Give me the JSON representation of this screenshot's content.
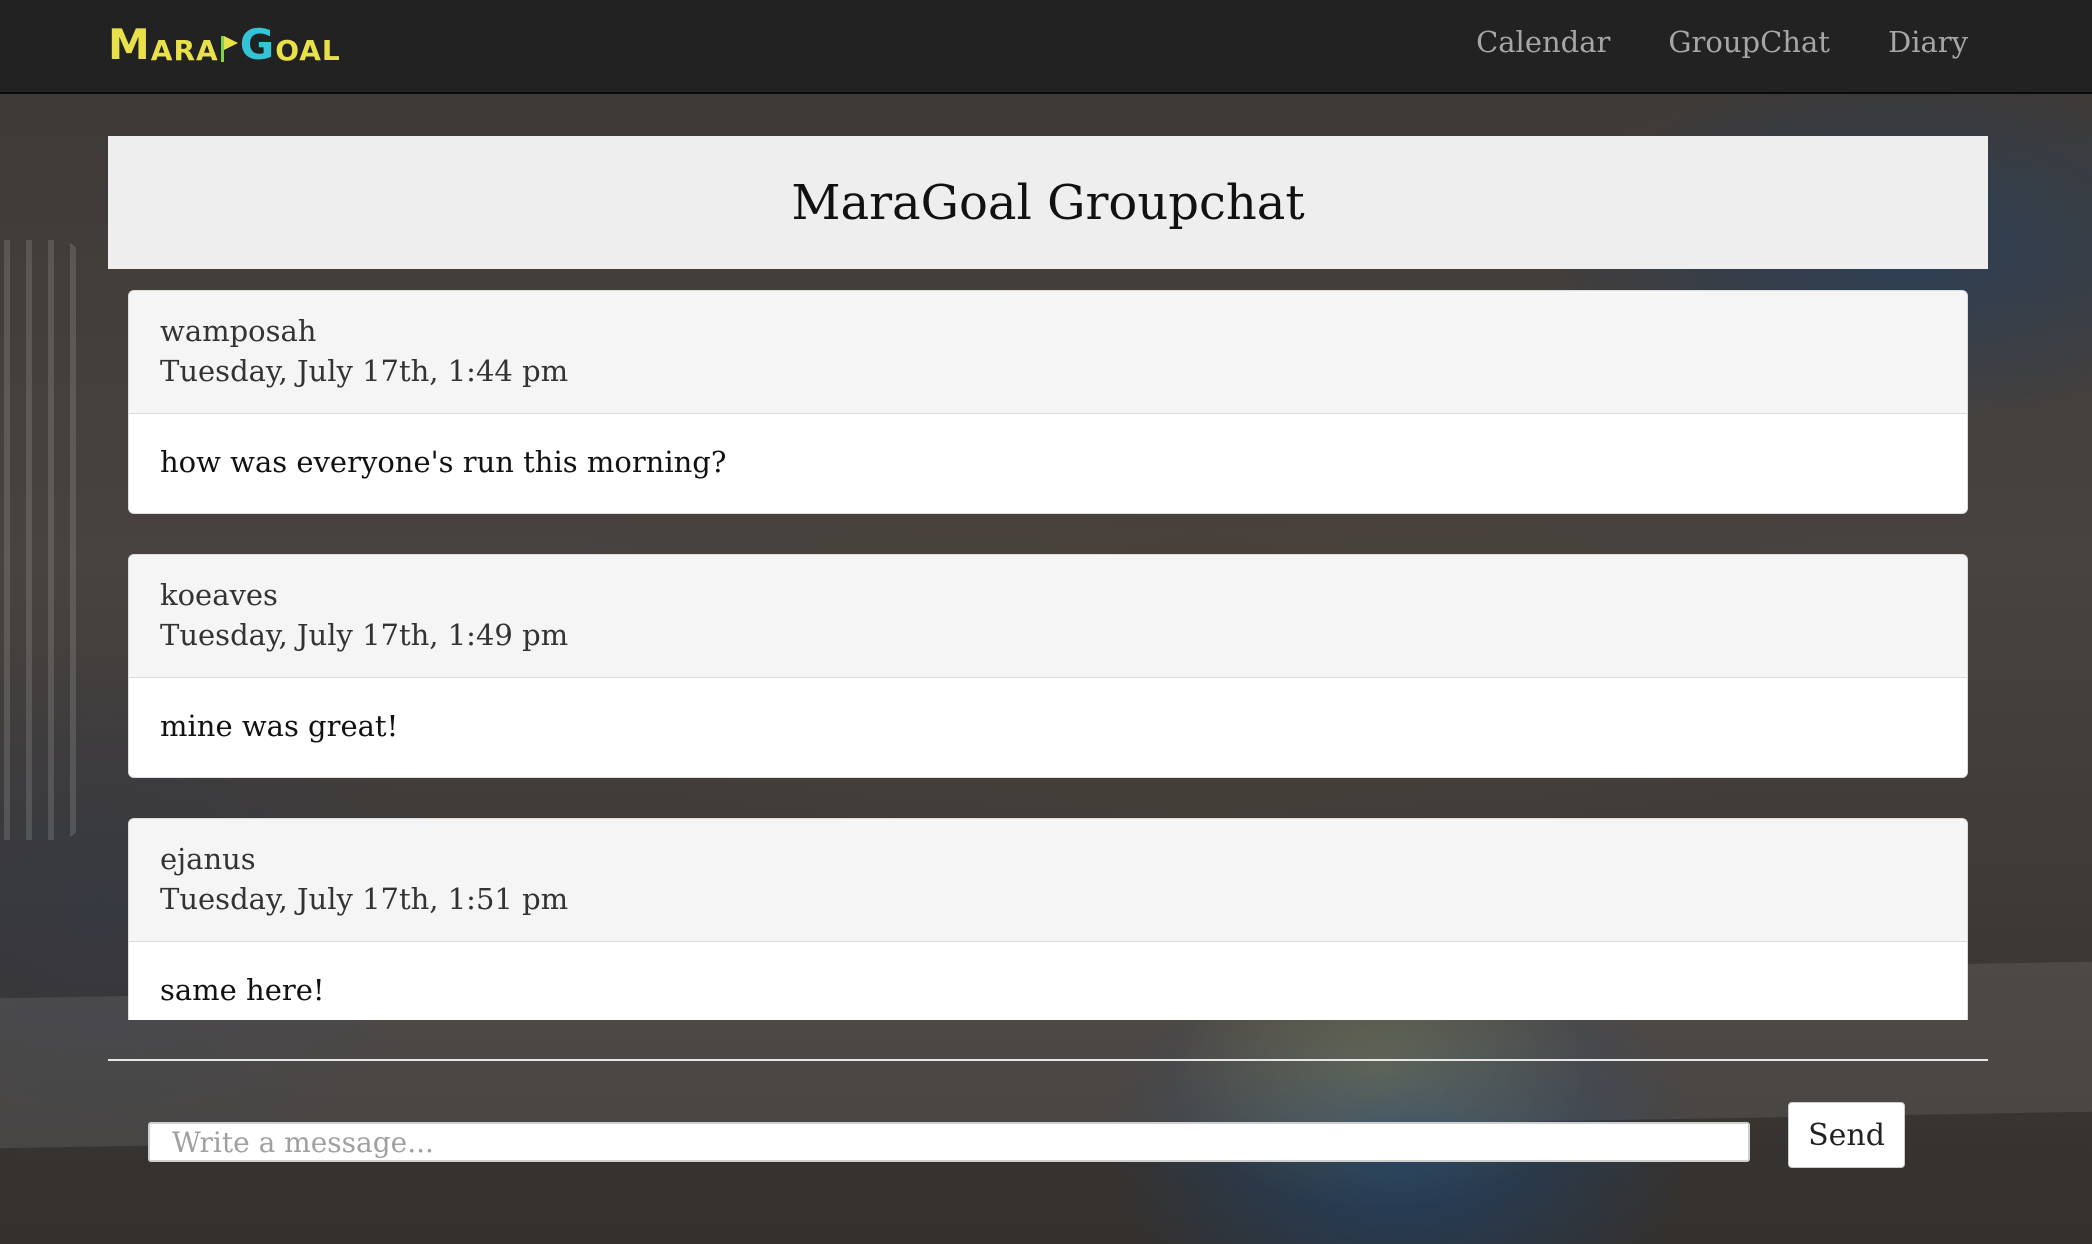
{
  "brand": {
    "logo_first_m": "M",
    "logo_ara": "ARA",
    "logo_g": "G",
    "logo_oal": "OAL",
    "colors": {
      "yellow": "#e8e14a",
      "cyan": "#35c3d6",
      "green": "#7fd24b"
    }
  },
  "nav": {
    "items": [
      {
        "label": "Calendar"
      },
      {
        "label": "GroupChat"
      },
      {
        "label": "Diary"
      }
    ]
  },
  "header": {
    "title": "MaraGoal Groupchat"
  },
  "messages": [
    {
      "user": "wamposah",
      "time": "Tuesday, July 17th, 1:44 pm",
      "text": "how was everyone's run this morning?"
    },
    {
      "user": "koeaves",
      "time": "Tuesday, July 17th, 1:49 pm",
      "text": "mine was great!"
    },
    {
      "user": "ejanus",
      "time": "Tuesday, July 17th, 1:51 pm",
      "text": "same here!"
    }
  ],
  "composer": {
    "placeholder": "Write a message...",
    "value": "",
    "send_label": "Send"
  }
}
